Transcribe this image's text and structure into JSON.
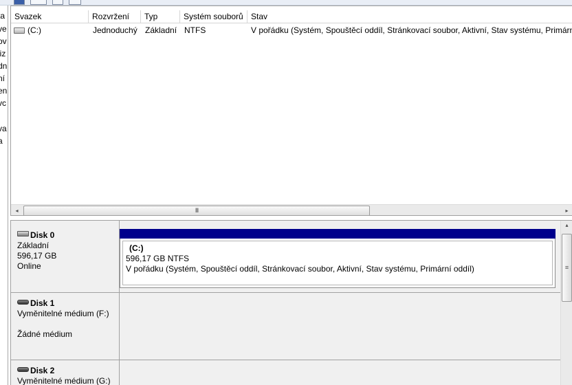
{
  "volume_list": {
    "columns": [
      "Svazek",
      "Rozvržení",
      "Typ",
      "Systém souborů",
      "Stav"
    ],
    "rows": [
      {
        "volume": "(C:)",
        "layout": "Jednoduchý",
        "type": "Základní",
        "filesystem": "NTFS",
        "status": "V pořádku (Systém, Spouštěcí oddíl, Stránkovací soubor, Aktivní, Stav systému, Primární"
      }
    ],
    "icon": "drive-icon"
  },
  "left_pane_fragments": [
    "ta",
    "ve",
    "ov",
    "liz",
    "dn",
    "ní",
    "en",
    "vc",
    "va",
    "a"
  ],
  "disks": [
    {
      "name": "Disk 0",
      "type": "Základní",
      "size": "596,17 GB",
      "status": "Online",
      "icon": "hard-disk-icon",
      "partition": {
        "label": "(C:)",
        "size_fs": "596,17 GB NTFS",
        "status": "V pořádku (Systém, Spouštěcí oddíl, Stránkovací soubor, Aktivní, Stav systému, Primární oddíl)",
        "bar_color": "#00008c"
      }
    },
    {
      "name": "Disk 1",
      "type": "Vyměnitelné médium (F:)",
      "status": "Žádné médium",
      "icon": "removable-disk-icon"
    },
    {
      "name": "Disk 2",
      "type": "Vyměnitelné médium (G:)",
      "icon": "removable-disk-icon"
    }
  ],
  "scrollbar": {
    "grip": "III",
    "left_arrow": "◂",
    "right_arrow": "▸",
    "up_arrow": "▴",
    "vgrip": "≡"
  }
}
